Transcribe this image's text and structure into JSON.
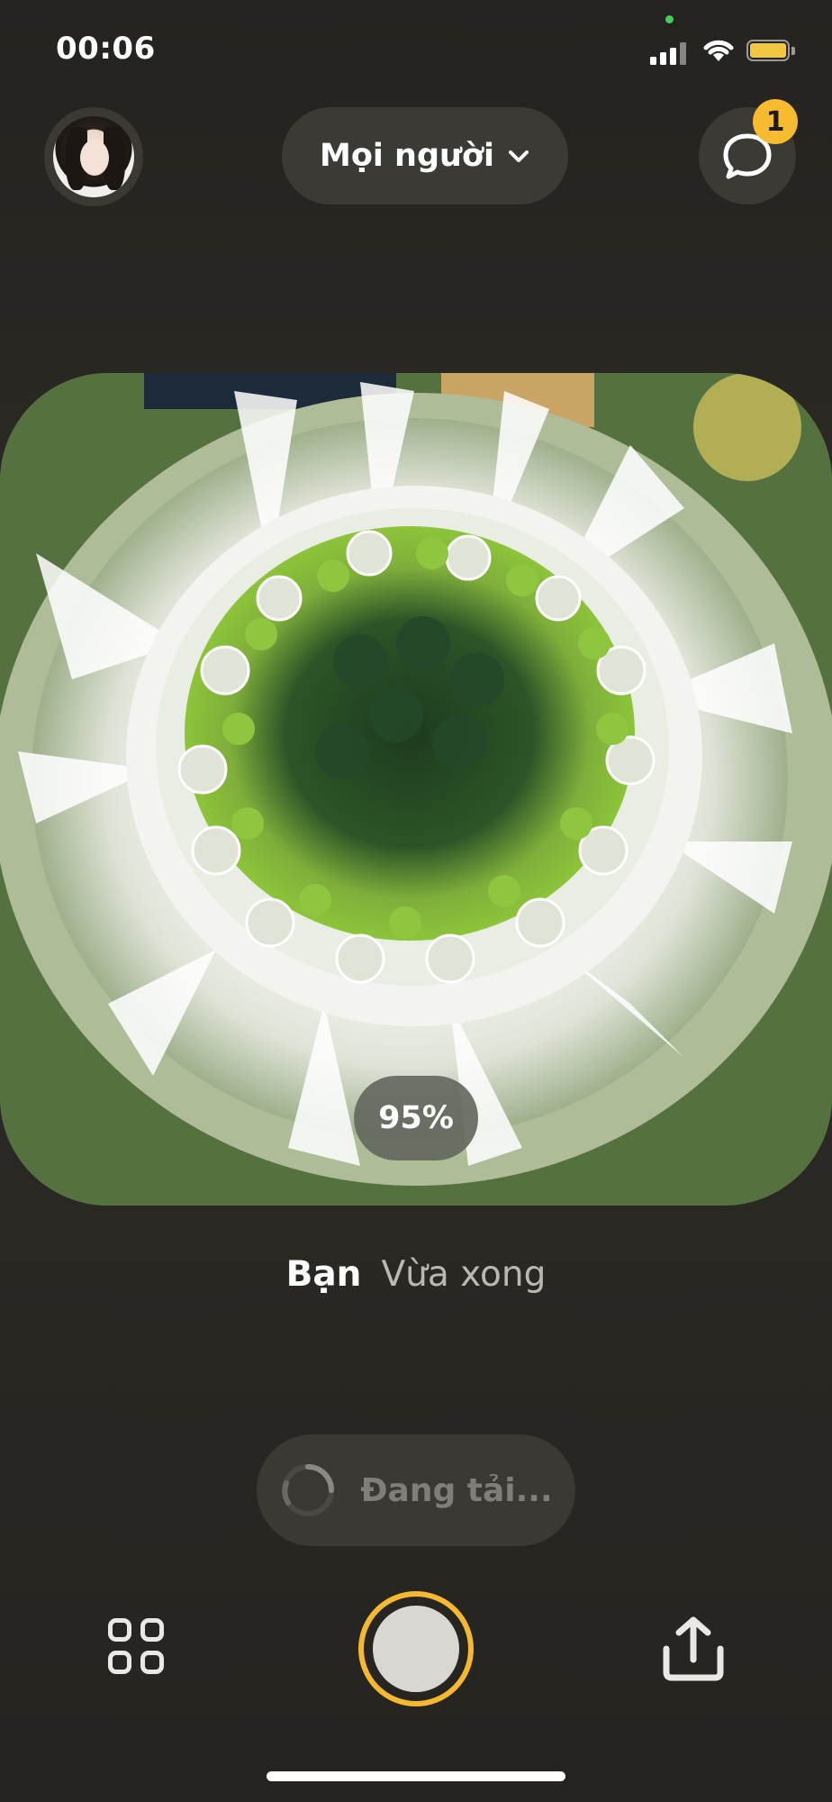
{
  "status_bar": {
    "time": "00:06",
    "icons": [
      "signal-icon",
      "wifi-icon",
      "battery-icon"
    ],
    "battery_color": "#f2c744"
  },
  "top_bar": {
    "avatar": "profile-avatar",
    "audience_label": "Mọi người",
    "chat_icon": "chat-bubble-icon",
    "chat_badge_count": "1",
    "badge_color": "#f6bb2f"
  },
  "photo": {
    "upload_percent": "95%"
  },
  "meta": {
    "author": "Bạn",
    "time_ago": "Vừa xong"
  },
  "upload": {
    "status_label": "Đang tải..."
  },
  "bottom_bar": {
    "left_icon": "grid-icon",
    "center": "shutter-button",
    "right_icon": "share-icon",
    "shutter_ring_color": "#f5b82e"
  }
}
